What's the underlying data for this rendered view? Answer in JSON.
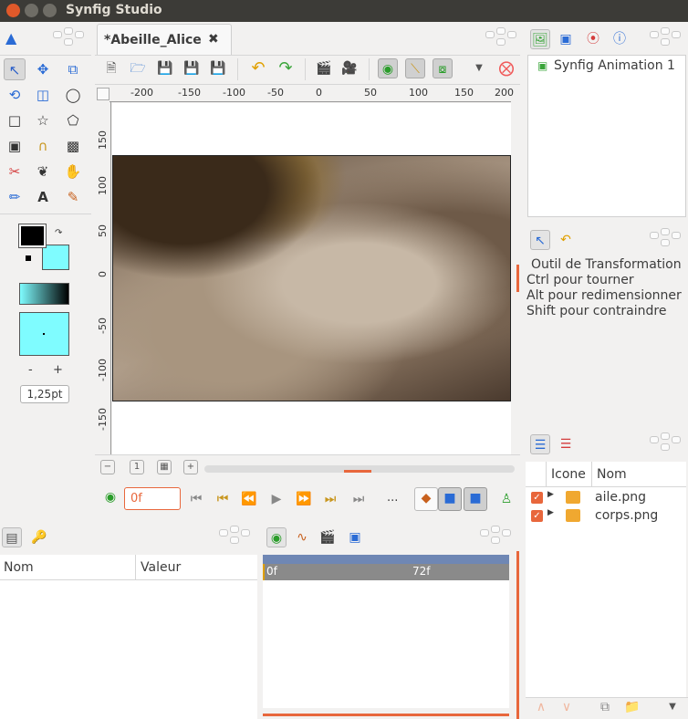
{
  "window": {
    "title": "Synfig Studio"
  },
  "document_tab": {
    "label": "*Abeille_Alice",
    "close_glyph": "✖"
  },
  "canvas_toolbar": {
    "icons": [
      "new-file-icon",
      "open-file-icon",
      "save-icon",
      "save-as-icon",
      "save-all-icon",
      "undo-icon",
      "redo-icon",
      "render-icon",
      "preview-icon",
      "onion-skin-icon",
      "show-handles-icon",
      "show-grid-icon",
      "dropdown-icon",
      "close-document-icon"
    ]
  },
  "ruler": {
    "h_labels": [
      "-200",
      "-150",
      "-100",
      "-50",
      "0",
      "50",
      "100",
      "150",
      "200"
    ],
    "v_labels": [
      "150",
      "100",
      "50",
      "0",
      "-50",
      "-100",
      "-150"
    ]
  },
  "toolbox": {
    "width_value": "1,25pt",
    "minus": "-",
    "plus": "+",
    "outline_color": "#000000",
    "fill_color": "#7ffcff"
  },
  "timebar": {
    "time_value": "0f",
    "ellipsis": "...",
    "start_label": "0f",
    "end_label": "72f"
  },
  "canvas_browser": {
    "item": "Synfig Animation 1"
  },
  "tool_options": {
    "lines": [
      "Outil de Transformation",
      "Ctrl pour tourner",
      "Alt pour redimensionner",
      "Shift pour contraindre"
    ]
  },
  "layers": {
    "col_icon": "Icone",
    "col_name": "Nom",
    "rows": [
      {
        "name": "aile.png"
      },
      {
        "name": "corps.png"
      }
    ]
  },
  "params": {
    "col_name": "Nom",
    "col_value": "Valeur"
  },
  "colors": {
    "accent": "#e8673c",
    "titlebar": "#3c3b37",
    "fill": "#7ffcff"
  }
}
